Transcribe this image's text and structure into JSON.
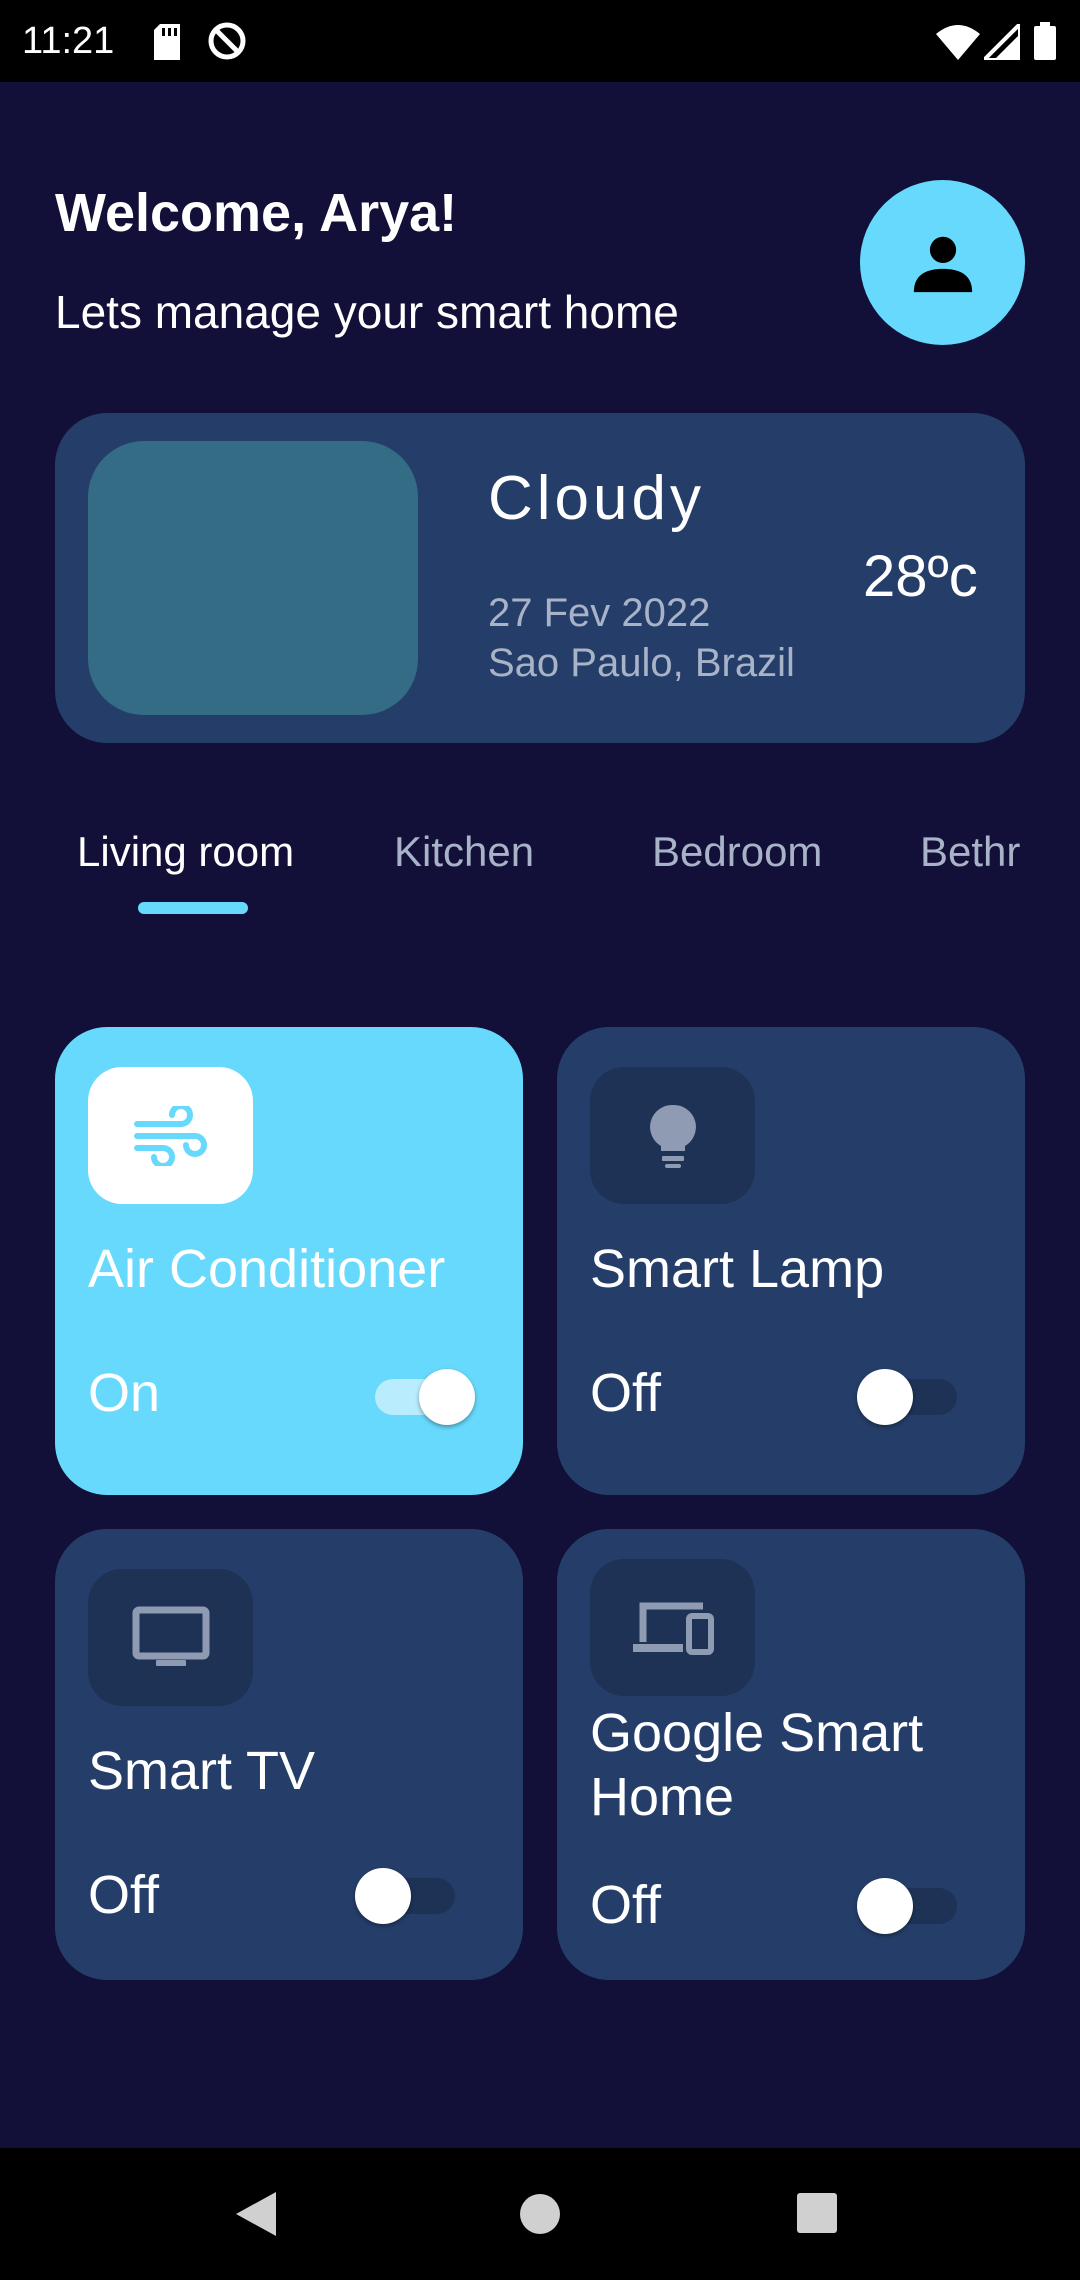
{
  "status_bar": {
    "time": "11:21"
  },
  "header": {
    "welcome": "Welcome, Arya!",
    "subtitle": "Lets manage your smart home"
  },
  "weather": {
    "condition": "Cloudy",
    "date": "27 Fev 2022",
    "location": "Sao Paulo, Brazil",
    "temperature": "28ºc"
  },
  "tabs": [
    "Living room",
    "Kitchen",
    "Bedroom",
    "Bethr"
  ],
  "devices": [
    {
      "name": "Air Conditioner",
      "state": "On",
      "icon": "air-icon"
    },
    {
      "name": "Smart Lamp",
      "state": "Off",
      "icon": "lightbulb-icon"
    },
    {
      "name": "Smart TV",
      "state": "Off",
      "icon": "tv-icon"
    },
    {
      "name": "Google Smart Home",
      "state": "Off",
      "icon": "devices-icon"
    }
  ],
  "colors": {
    "background": "#121038",
    "card": "#253e69",
    "accent": "#67d9fc",
    "muted_text": "#a9b3c8"
  }
}
